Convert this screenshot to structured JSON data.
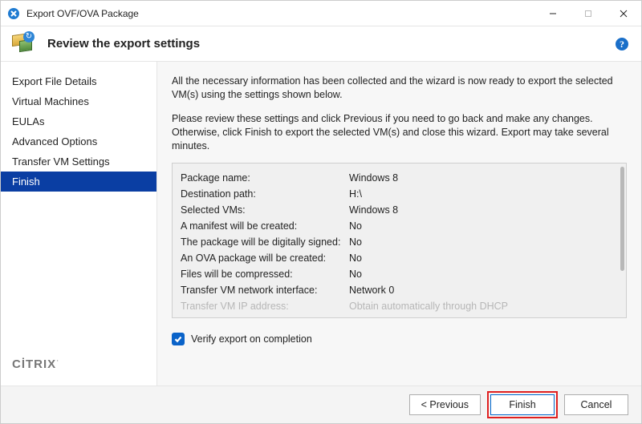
{
  "window": {
    "title": "Export OVF/OVA Package"
  },
  "header": {
    "title": "Review the export settings"
  },
  "sidebar": {
    "items": [
      {
        "label": "Export File Details"
      },
      {
        "label": "Virtual Machines"
      },
      {
        "label": "EULAs"
      },
      {
        "label": "Advanced Options"
      },
      {
        "label": "Transfer VM Settings"
      },
      {
        "label": "Finish"
      }
    ]
  },
  "brand": {
    "prefix": "CİTRIX",
    "dot": "˙"
  },
  "main": {
    "para1": "All the necessary information has been collected and the wizard is now ready to export the selected VM(s) using the settings shown below.",
    "para2": "Please review these settings and click Previous if you need to go back and make any changes. Otherwise, click Finish to export the selected VM(s) and close this wizard. Export may take several minutes.",
    "summary": {
      "rows": [
        {
          "k": "Package name:",
          "v": "Windows 8"
        },
        {
          "k": "Destination path:",
          "v": "H:\\"
        },
        {
          "k": "Selected VMs:",
          "v": "Windows 8"
        },
        {
          "k": "A manifest will be created:",
          "v": "No"
        },
        {
          "k": "The package will be digitally signed:",
          "v": "No"
        },
        {
          "k": "An OVA package will be created:",
          "v": "No"
        },
        {
          "k": "Files will be compressed:",
          "v": "No"
        },
        {
          "k": "Transfer VM network interface:",
          "v": "Network 0"
        },
        {
          "k": "Transfer VM IP address:",
          "v": "Obtain automatically through DHCP"
        }
      ]
    },
    "verify_label": "Verify export on completion",
    "verify_checked": true
  },
  "footer": {
    "previous": "<  Previous",
    "finish": "Finish",
    "cancel": "Cancel"
  }
}
